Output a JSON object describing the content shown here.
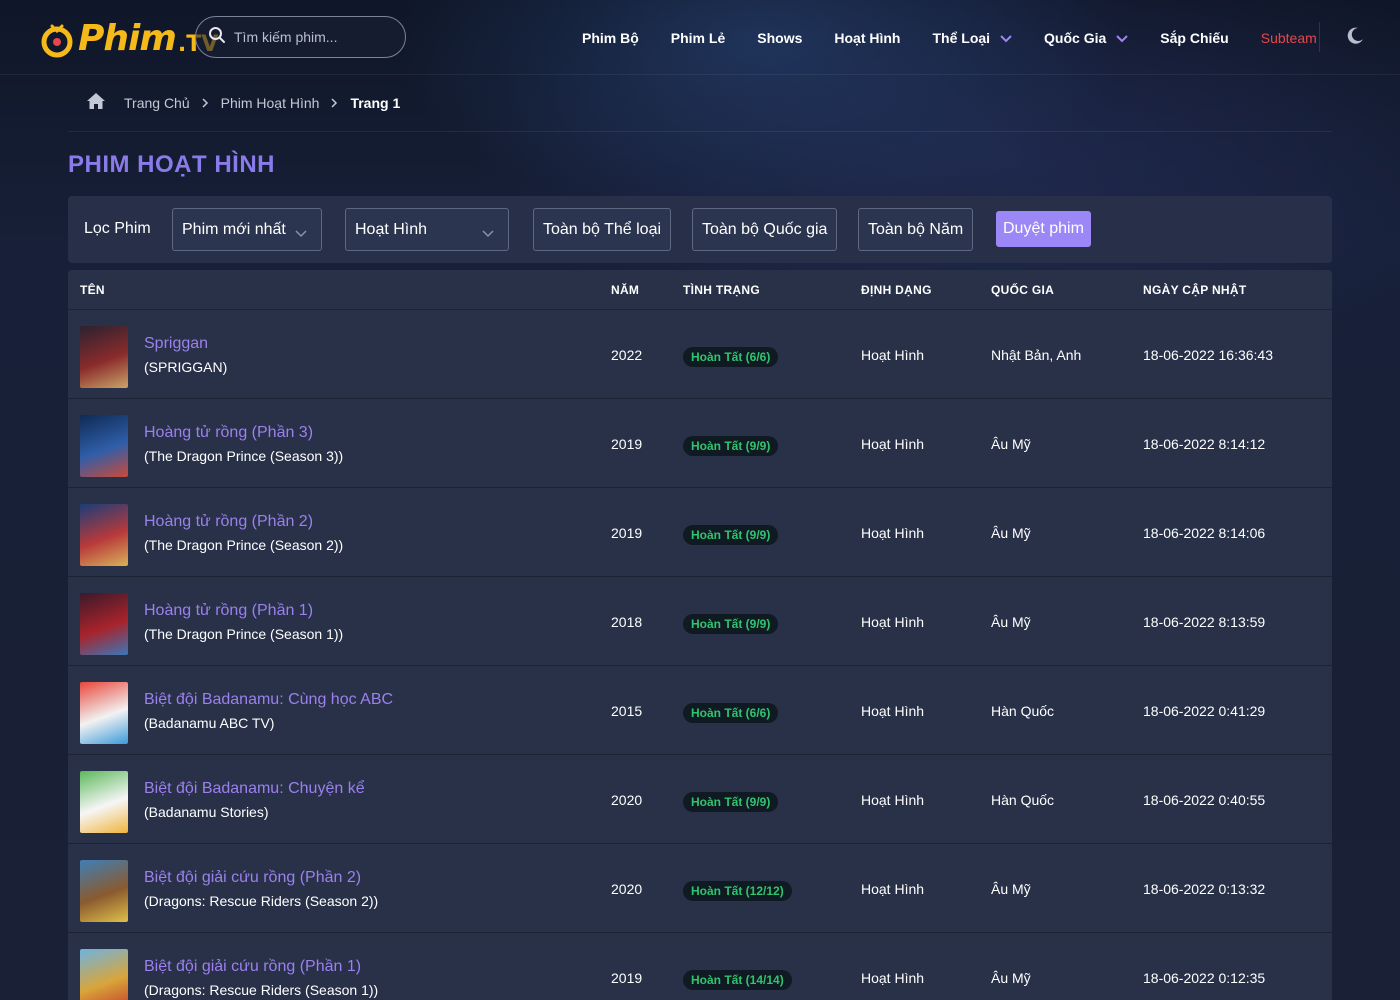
{
  "header": {
    "logo_text": "Phim",
    "logo_suffix": ".TV",
    "search_placeholder": "Tìm kiếm phim...",
    "nav": [
      {
        "label": "Phim Bộ"
      },
      {
        "label": "Phim Lẻ"
      },
      {
        "label": "Shows"
      },
      {
        "label": "Hoạt Hình"
      },
      {
        "label": "Thể Loại",
        "dropdown": true
      },
      {
        "label": "Quốc Gia",
        "dropdown": true
      },
      {
        "label": "Sắp Chiếu"
      },
      {
        "label": "Subteam"
      }
    ],
    "theme_icon": "moon-icon"
  },
  "breadcrumb": {
    "home_icon": "home-icon",
    "items": [
      "Trang Chủ",
      "Phim Hoạt Hình"
    ],
    "current": "Trang 1"
  },
  "page_title": "PHIM HOẠT HÌNH",
  "filter": {
    "label": "Lọc Phim",
    "sort_value": "Phim mới nhất",
    "type_value": "Hoạt Hình",
    "genre_label": "Toàn bộ Thể loại",
    "country_label": "Toàn bộ Quốc gia",
    "year_label": "Toàn bộ Năm",
    "submit_label": "Duyệt phim"
  },
  "table": {
    "columns": [
      "TÊN",
      "NĂM",
      "TÌNH TRẠNG",
      "ĐỊNH DẠNG",
      "QUỐC GIA",
      "NGÀY CẬP NHẬT"
    ],
    "rows": [
      {
        "title": "Spriggan",
        "original": "(SPRIGGAN)",
        "year": "2022",
        "status": "Hoàn Tất (6/6)",
        "format": "Hoạt Hình",
        "country": "Nhật Bản, Anh",
        "updated": "18-06-2022 16:36:43",
        "thumb_colors": [
          "#2a2230",
          "#8a2b2b",
          "#c9a46a"
        ]
      },
      {
        "title": "Hoàng tử rồng (Phần 3)",
        "original": "(The Dragon Prince (Season 3))",
        "year": "2019",
        "status": "Hoàn Tất (9/9)",
        "format": "Hoạt Hình",
        "country": "Âu Mỹ",
        "updated": "18-06-2022 8:14:12",
        "thumb_colors": [
          "#0e2a55",
          "#2f5ea8",
          "#c94a3a"
        ]
      },
      {
        "title": "Hoàng tử rồng (Phần 2)",
        "original": "(The Dragon Prince (Season 2))",
        "year": "2019",
        "status": "Hoàn Tất (9/9)",
        "format": "Hoạt Hình",
        "country": "Âu Mỹ",
        "updated": "18-06-2022 8:14:06",
        "thumb_colors": [
          "#1a3d7a",
          "#b83a3a",
          "#d8b25a"
        ]
      },
      {
        "title": "Hoàng tử rồng (Phần 1)",
        "original": "(The Dragon Prince (Season 1))",
        "year": "2018",
        "status": "Hoàn Tất (9/9)",
        "format": "Hoạt Hình",
        "country": "Âu Mỹ",
        "updated": "18-06-2022 8:13:59",
        "thumb_colors": [
          "#3a1a2a",
          "#a8232b",
          "#3b78b8"
        ]
      },
      {
        "title": "Biệt đội Badanamu: Cùng học ABC",
        "original": "(Badanamu ABC TV)",
        "year": "2015",
        "status": "Hoàn Tất (6/6)",
        "format": "Hoạt Hình",
        "country": "Hàn Quốc",
        "updated": "18-06-2022 0:41:29",
        "thumb_colors": [
          "#e8473a",
          "#f2f2f2",
          "#3a9ad9"
        ]
      },
      {
        "title": "Biệt đội Badanamu: Chuyện kể",
        "original": "(Badanamu Stories)",
        "year": "2020",
        "status": "Hoàn Tất (9/9)",
        "format": "Hoạt Hình",
        "country": "Hàn Quốc",
        "updated": "18-06-2022 0:40:55",
        "thumb_colors": [
          "#5cb85c",
          "#f6f6f6",
          "#f0b43c"
        ]
      },
      {
        "title": "Biệt đội giải cứu rồng (Phần 2)",
        "original": "(Dragons: Rescue Riders (Season 2))",
        "year": "2020",
        "status": "Hoàn Tất (12/12)",
        "format": "Hoạt Hình",
        "country": "Âu Mỹ",
        "updated": "18-06-2022 0:13:32",
        "thumb_colors": [
          "#3f7fb8",
          "#8a5a2e",
          "#e0c04a"
        ]
      },
      {
        "title": "Biệt đội giải cứu rồng (Phần 1)",
        "original": "(Dragons: Rescue Riders (Season 1))",
        "year": "2019",
        "status": "Hoàn Tất (14/14)",
        "format": "Hoạt Hình",
        "country": "Âu Mỹ",
        "updated": "18-06-2022 0:12:35",
        "thumb_colors": [
          "#6fb3e0",
          "#d9a53a",
          "#c23a2a"
        ]
      }
    ]
  },
  "colors": {
    "accent": "#9b87f5",
    "title_link": "#9b80ee",
    "status_green": "#2fc46f",
    "subteam_red": "#e8464a",
    "logo_yellow": "#f5b91a"
  }
}
